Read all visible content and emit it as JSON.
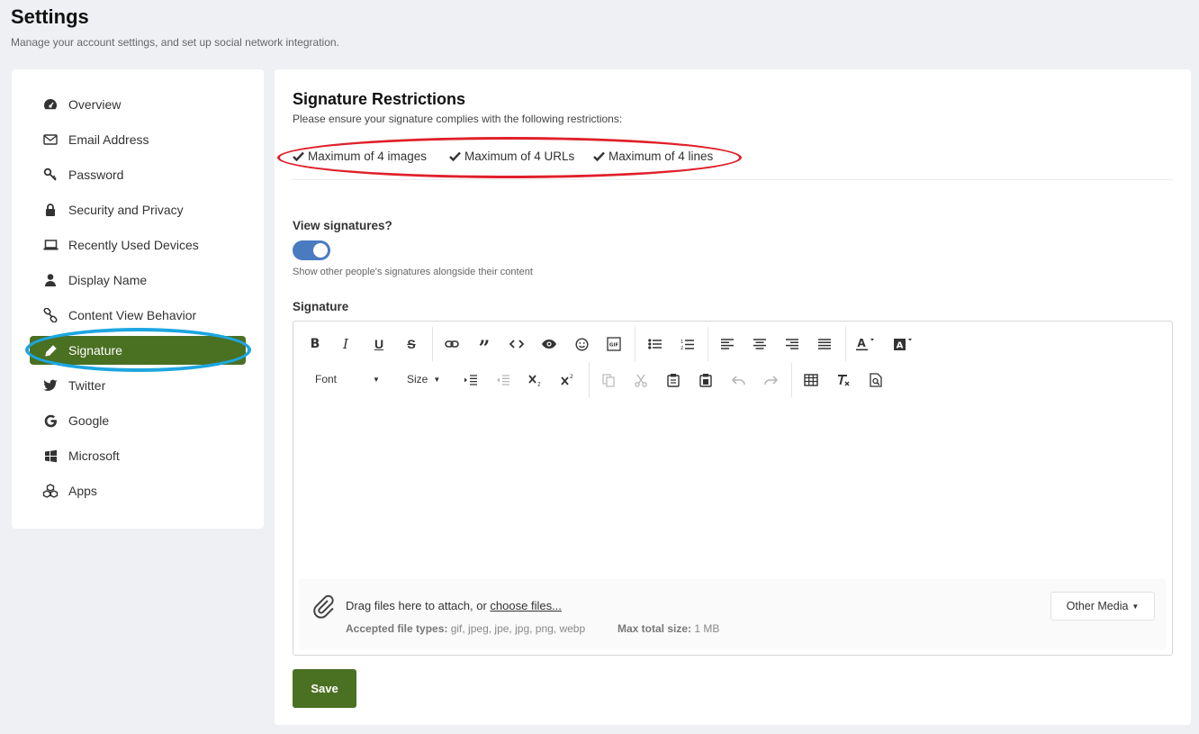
{
  "header": {
    "title": "Settings",
    "subtitle": "Manage your account settings, and set up social network integration."
  },
  "sidebar": {
    "items": [
      {
        "label": "Overview",
        "icon": "dashboard-icon"
      },
      {
        "label": "Email Address",
        "icon": "envelope-icon"
      },
      {
        "label": "Password",
        "icon": "key-icon"
      },
      {
        "label": "Security and Privacy",
        "icon": "lock-icon"
      },
      {
        "label": "Recently Used Devices",
        "icon": "laptop-icon"
      },
      {
        "label": "Display Name",
        "icon": "user-icon"
      },
      {
        "label": "Content View Behavior",
        "icon": "link-icon"
      },
      {
        "label": "Signature",
        "icon": "pencil-icon",
        "active": true
      },
      {
        "label": "Twitter",
        "icon": "twitter-icon"
      },
      {
        "label": "Google",
        "icon": "google-icon"
      },
      {
        "label": "Microsoft",
        "icon": "windows-icon"
      },
      {
        "label": "Apps",
        "icon": "cubes-icon"
      }
    ]
  },
  "main": {
    "title": "Signature Restrictions",
    "subtitle": "Please ensure your signature complies with the following restrictions:",
    "restrictions": [
      "Maximum of 4 images",
      "Maximum of 4 URLs",
      "Maximum of 4 lines"
    ],
    "view_signatures_label": "View signatures?",
    "view_signatures_enabled": true,
    "view_signatures_help": "Show other people's signatures alongside their content",
    "signature_label": "Signature",
    "editor": {
      "font_label": "Font",
      "size_label": "Size",
      "attach_text": "Drag files here to attach, or ",
      "attach_link": "choose files...",
      "accepted_label": "Accepted file types:",
      "accepted_value": "gif, jpeg, jpe, jpg, png, webp",
      "max_label": "Max total size:",
      "max_value": "1 MB",
      "other_media": "Other Media"
    },
    "save_label": "Save"
  },
  "colors": {
    "accent": "#4a7022",
    "toggle": "#4a7bc0",
    "annotation_red": "#e0202a",
    "annotation_blue": "#1da6e0"
  }
}
